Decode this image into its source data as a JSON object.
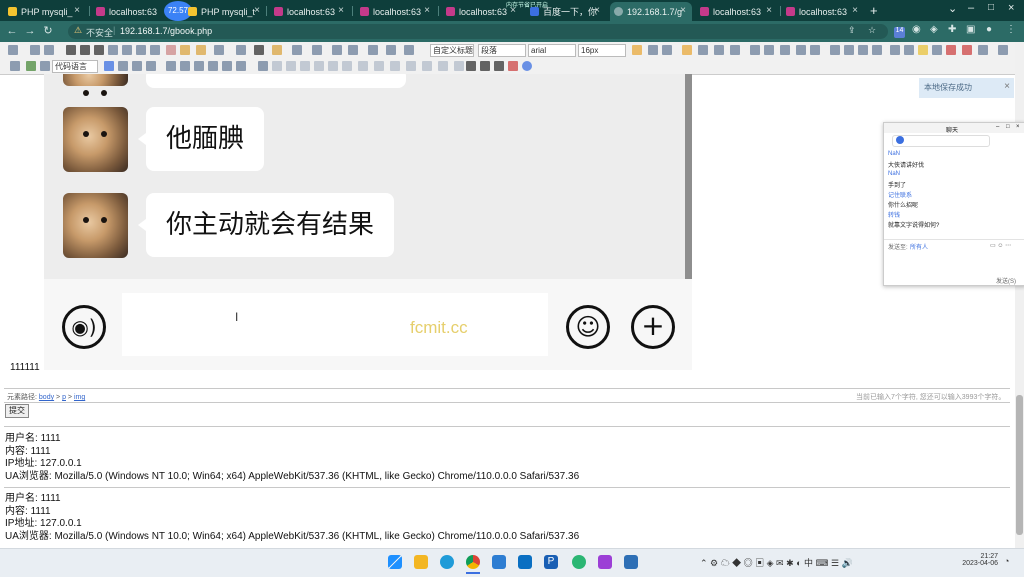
{
  "browser": {
    "tabs": [
      {
        "title": "PHP mysqli_",
        "color": "#f4c430"
      },
      {
        "title": "localhost:63",
        "color": "#c43a8a"
      },
      {
        "title": "PHP mysqli_t",
        "color": "#f4c430"
      },
      {
        "title": "localhost:63",
        "color": "#c43a8a"
      },
      {
        "title": "localhost:63",
        "color": "#c43a8a"
      },
      {
        "title": "localhost:63",
        "color": "#c43a8a"
      },
      {
        "title": "百度一下，你",
        "color": "#3b6fe0"
      },
      {
        "title": "192.168.1.7/g",
        "color": "#8aa"
      },
      {
        "title": "localhost:63",
        "color": "#c43a8a"
      },
      {
        "title": "localhost:63",
        "color": "#c43a8a"
      }
    ],
    "tab_badge": "72.57",
    "tab_hint": "内存节省已开启",
    "new_tab": "+",
    "security": "不安全",
    "url": "192.168.1.7/gbook.php",
    "profile_badge": "14"
  },
  "editor": {
    "font_select": "arial",
    "size_select": "16px",
    "format_select": "段落",
    "style_select": "自定义标题",
    "code_select": "代码语言",
    "path_label": "元素路径:",
    "path": [
      "body",
      "p",
      "img"
    ],
    "char_count": "当前已输入7个字符, 您还可以输入3993个字符。",
    "submit": "提交"
  },
  "chat_image": {
    "messages": [
      "他腼腆",
      "你主动就会有结果"
    ],
    "watermark": "fcmit.cc"
  },
  "content_text": "111111",
  "notification": {
    "text": "本地保存成功",
    "close": "×"
  },
  "mini_window": {
    "title": "聊天",
    "lines": [
      "NaN",
      "大侠请讲好伐",
      "NaN",
      "手到了",
      "记住联系",
      "你什么招呢",
      "转钱",
      "就靠文字说得如何?"
    ],
    "footer_left": "发送至:",
    "footer_target": "所有人",
    "footer_right": "发送(S)"
  },
  "records": [
    {
      "username_label": "用户名:",
      "username": "1111",
      "content_label": "内容:",
      "content": "1111",
      "ip_label": "IP地址:",
      "ip": "127.0.0.1",
      "ua_label": "UA浏览器:",
      "ua": "Mozilla/5.0 (Windows NT 10.0; Win64; x64) AppleWebKit/537.36 (KHTML, like Gecko) Chrome/110.0.0.0 Safari/537.36"
    },
    {
      "username_label": "用户名:",
      "username": "1111",
      "content_label": "内容:",
      "content": "1111",
      "ip_label": "IP地址:",
      "ip": "127.0.0.1",
      "ua_label": "UA浏览器:",
      "ua": "Mozilla/5.0 (Windows NT 10.0; Win64; x64) AppleWebKit/537.36 (KHTML, like Gecko) Chrome/110.0.0.0 Safari/537.36"
    }
  ],
  "taskbar": {
    "time": "21:27",
    "date": "2023-04-06",
    "lang": "中",
    "icons": [
      "windows-start-icon",
      "file-explorer-icon",
      "edge-icon",
      "chrome-icon",
      "app-icon",
      "photos-icon",
      "phpstorm-icon",
      "app2-icon",
      "vscode-icon",
      "notepad-icon"
    ]
  }
}
